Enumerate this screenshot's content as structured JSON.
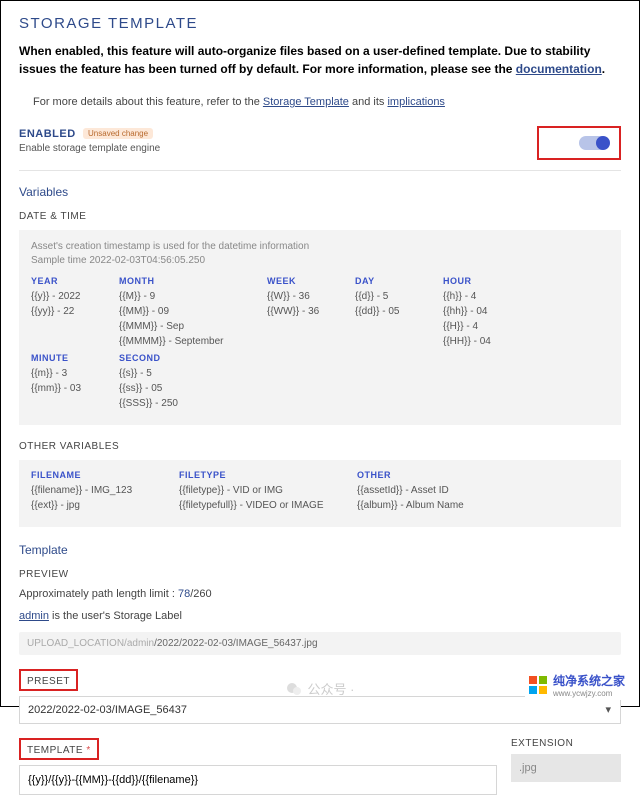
{
  "title": "STORAGE TEMPLATE",
  "description_a": "When enabled, this feature will auto-organize files based on a user-defined template. Due to stability issues the feature has been turned off by default. For more information, please see the ",
  "description_link": "documentation",
  "sub_a": "For more details about this feature, refer to the ",
  "sub_link1": "Storage Template",
  "sub_mid": " and its ",
  "sub_link2": "implications",
  "enabled": {
    "label": "ENABLED",
    "badge": "Unsaved change",
    "sub": "Enable storage template engine"
  },
  "variables": {
    "heading": "Variables",
    "datetime_label": "DATE & TIME",
    "meta1": "Asset's creation timestamp is used for the datetime information",
    "meta2": "Sample time 2022-02-03T04:56:05.250",
    "cols": {
      "year": {
        "h": "YEAR",
        "lines": [
          "{{y}} - 2022",
          "{{yy}} - 22"
        ]
      },
      "month": {
        "h": "MONTH",
        "lines": [
          "{{M}} - 9",
          "{{MM}} - 09",
          "{{MMM}} - Sep",
          "{{MMMM}} - September"
        ]
      },
      "week": {
        "h": "WEEK",
        "lines": [
          "{{W}} - 36",
          "{{WW}} - 36"
        ]
      },
      "day": {
        "h": "DAY",
        "lines": [
          "{{d}} - 5",
          "{{dd}} - 05"
        ]
      },
      "hour": {
        "h": "HOUR",
        "lines": [
          "{{h}} - 4",
          "{{hh}} - 04",
          "{{H}} - 4",
          "{{HH}} - 04"
        ]
      },
      "minute": {
        "h": "MINUTE",
        "lines": [
          "{{m}} - 3",
          "{{mm}} - 03"
        ]
      },
      "second": {
        "h": "SECOND",
        "lines": [
          "{{s}} - 5",
          "{{ss}} - 05",
          "{{SSS}} - 250"
        ]
      }
    },
    "other_label": "OTHER VARIABLES",
    "other": {
      "filename": {
        "h": "FILENAME",
        "lines": [
          "{{filename}} - IMG_123",
          "{{ext}} - jpg"
        ]
      },
      "filetype": {
        "h": "FILETYPE",
        "lines": [
          "{{filetype}} - VID or IMG",
          "{{filetypefull}} - VIDEO or IMAGE"
        ]
      },
      "other": {
        "h": "OTHER",
        "lines": [
          "{{assetId}} - Asset ID",
          "{{album}} - Album Name"
        ]
      }
    }
  },
  "template": {
    "heading": "Template",
    "preview_label": "PREVIEW",
    "approx_a": "Approximately path length limit : ",
    "approx_num": "78",
    "approx_b": "/260",
    "admin": "admin",
    "admin_rest": " is the user's Storage Label",
    "path_grey": "UPLOAD_LOCATION/admin",
    "path_dark": "/2022/2022-02-03/IMAGE_56437.jpg",
    "preset_label": "PRESET",
    "preset_value": "2022/2022-02-03/IMAGE_56437",
    "template_label": "TEMPLATE",
    "template_value": "{{y}}/{{y}}-{{MM}}-{{dd}}/{{filename}}",
    "extension_label": "EXTENSION",
    "extension_value": ".jpg"
  },
  "watermark": "公众号 ·",
  "footer": {
    "t": "纯净系统之家",
    "s": "www.ycwjzy.com"
  }
}
